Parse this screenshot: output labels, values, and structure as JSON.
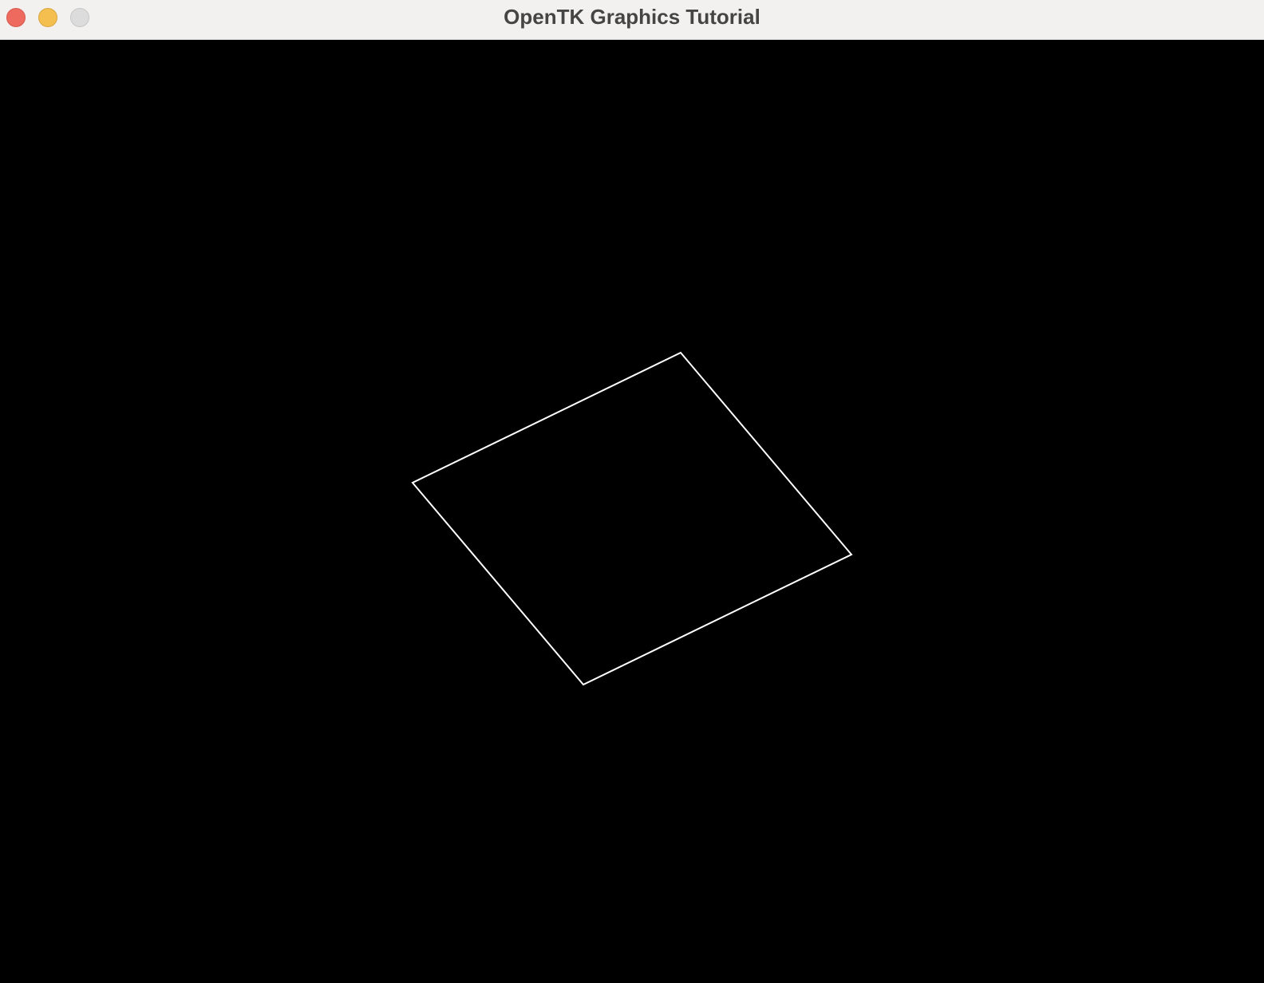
{
  "window": {
    "title": "OpenTK Graphics Tutorial",
    "controls": [
      "close",
      "minimize",
      "zoom"
    ]
  },
  "scene": {
    "background_color": "#000000",
    "shape": "quad-wireframe",
    "line_color": "#ffffff"
  }
}
